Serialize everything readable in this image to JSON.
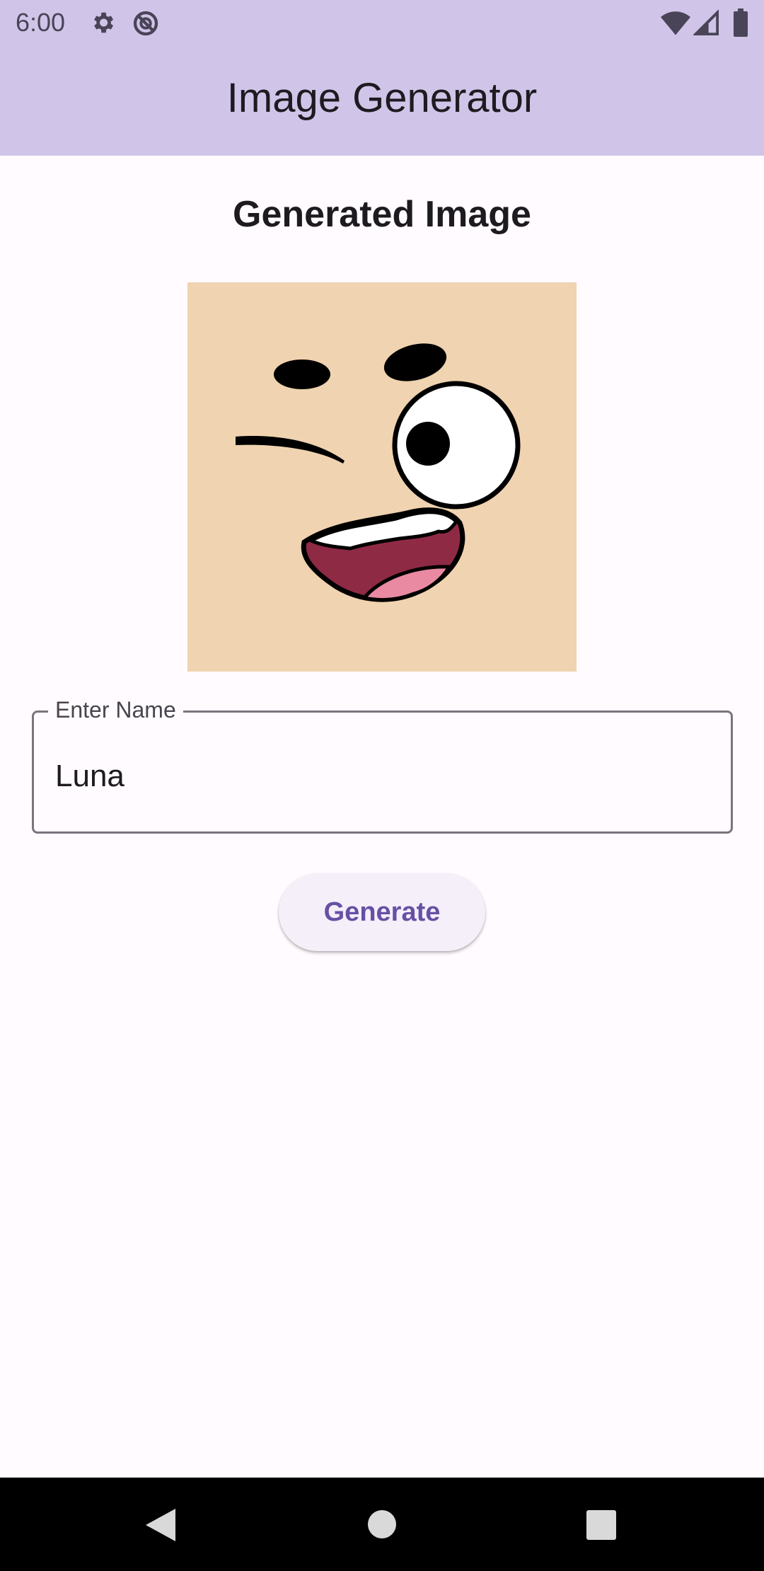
{
  "status_bar": {
    "time": "6:00",
    "left_icons": [
      "gear-icon",
      "no-sync-icon"
    ],
    "right_icons": [
      "wifi-icon",
      "cell-signal-icon",
      "battery-icon"
    ]
  },
  "app_bar": {
    "title": "Image Generator"
  },
  "main": {
    "section_title": "Generated Image",
    "image_icon": "cartoon-face-image",
    "name_field": {
      "label": "Enter Name",
      "value": "Luna"
    },
    "generate_button_label": "Generate"
  },
  "nav_bar": {
    "icons": [
      "back-icon",
      "home-icon",
      "recents-icon"
    ]
  },
  "colors": {
    "app_bar": "#d0c5e8",
    "background": "#fffbfe",
    "accent": "#6750a4",
    "image_background": "#f0d3b0",
    "mouth": "#8f2a45",
    "tongue": "#e98aa2"
  }
}
